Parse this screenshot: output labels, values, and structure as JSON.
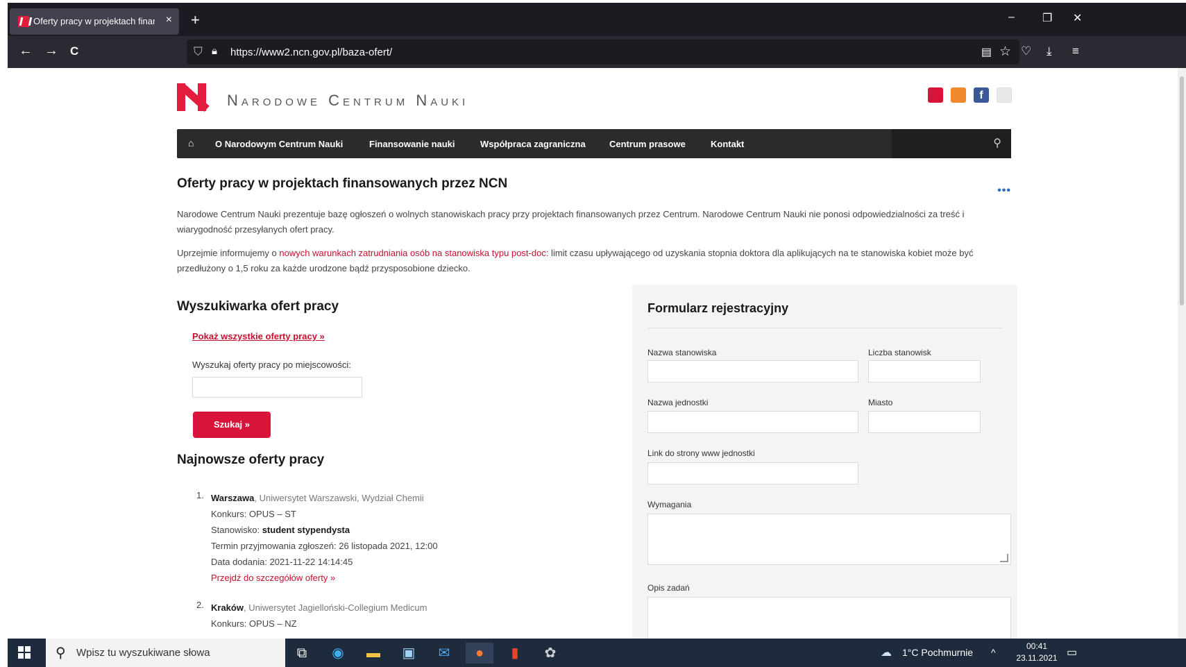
{
  "browser": {
    "tab_title": "Oferty pracy w projektach finan",
    "tab_close": "×",
    "new_tab": "+",
    "url": "https://www2.ncn.gov.pl/baza-ofert/",
    "back": "←",
    "forward": "→",
    "reload": "C",
    "minimize": "–",
    "restore": "❐",
    "close": "✕"
  },
  "site": {
    "brand": "Narodowe Centrum Nauki",
    "menu": [
      "O Narodowym Centrum Nauki",
      "Finansowanie nauki",
      "Współpraca zagraniczna",
      "Centrum prasowe",
      "Kontakt"
    ],
    "accent_color": "#e31c3d"
  },
  "page": {
    "title": "Oferty pracy w projektach finansowanych przez NCN",
    "intro": "Narodowe Centrum Nauki prezentuje bazę ogłoszeń o wolnych stanowiskach pracy przy projektach finansowanych przez Centrum. Narodowe Centrum Nauki nie ponosi odpowiedzialności za treść i wiarygodność przesyłanych ofert pracy.",
    "notice_prefix": "Uprzejmie informujemy o ",
    "notice_link": "nowych warunkach zatrudniania osób na stanowiska typu post-doc",
    "notice_suffix": ": limit czasu upływającego od uzyskania stopnia doktora dla aplikujących na te stanowiska kobiet może być przedłużony o 1,5 roku za każde urodzone bądź przysposobione dziecko."
  },
  "search": {
    "heading": "Wyszukiwarka ofert pracy",
    "show_all": "Pokaż wszystkie oferty pracy »",
    "city_label": "Wyszukaj oferty pracy po miejscowości:",
    "button": "Szukaj »"
  },
  "latest": {
    "heading": "Najnowsze oferty pracy",
    "offers": [
      {
        "num": "1.",
        "city": "Warszawa",
        "institution": ", Uniwersytet Warszawski, Wydział Chemii",
        "contest": "Konkurs: OPUS – ST",
        "position_label": "Stanowisko: ",
        "position": "student stypendysta",
        "deadline": "Termin przyjmowania zgłoszeń: 26 listopada 2021, 12:00",
        "added": "Data dodania: 2021-11-22 14:14:45",
        "details": "Przejdź do szczegółów oferty »"
      },
      {
        "num": "2.",
        "city": "Kraków",
        "institution": ", Uniwersytet Jagielloński-Collegium Medicum",
        "contest": "Konkurs: OPUS – NZ"
      }
    ]
  },
  "form": {
    "heading": "Formularz rejestracyjny",
    "position_name": "Nazwa stanowiska",
    "positions_count": "Liczba stanowisk",
    "unit_name": "Nazwa jednostki",
    "city": "Miasto",
    "unit_link": "Link do strony www jednostki",
    "requirements": "Wymagania",
    "tasks": "Opis zadań"
  },
  "taskbar": {
    "search_placeholder": "Wpisz tu wyszukiwane słowa",
    "weather": "1°C  Pochmurnie",
    "time": "00:41",
    "date": "23.11.2021"
  }
}
